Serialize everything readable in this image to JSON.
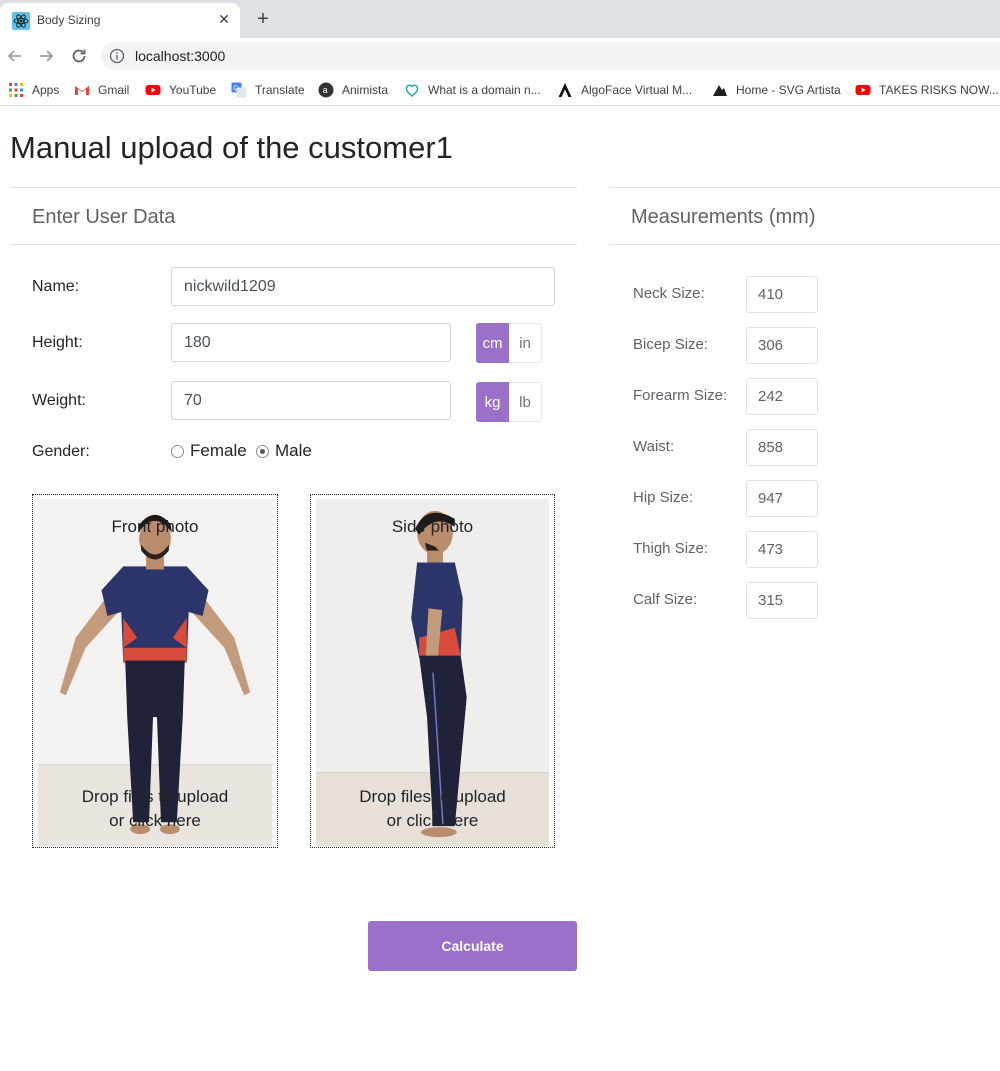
{
  "browser": {
    "tab_title": "Body Sizing",
    "url": "localhost:3000",
    "bookmarks": [
      "Apps",
      "Gmail",
      "YouTube",
      "Translate",
      "Animista",
      "What is a domain n...",
      "AlgoFace Virtual M...",
      "Home - SVG Artista",
      "TAKES RISKS NOW..."
    ]
  },
  "page": {
    "title": "Manual upload of the customer1"
  },
  "form": {
    "heading": "Enter User Data",
    "name_label": "Name:",
    "name_value": "nickwild1209",
    "height_label": "Height:",
    "height_value": "180",
    "height_units": [
      "cm",
      "in"
    ],
    "weight_label": "Weight:",
    "weight_value": "70",
    "weight_units": [
      "kg",
      "lb"
    ],
    "gender_label": "Gender:",
    "gender_options": [
      "Female",
      "Male"
    ],
    "gender_selected": "Male",
    "front": {
      "title": "Front photo",
      "hint": [
        "Drop files to upload",
        "or click here"
      ]
    },
    "side": {
      "title": "Side photo",
      "hint": [
        "Drop files to upload",
        "or click here"
      ]
    },
    "calculate_label": "Calculate"
  },
  "measurements": {
    "heading": "Measurements (mm)",
    "items": [
      {
        "label": "Neck Size:",
        "value": "410"
      },
      {
        "label": "Bicep Size:",
        "value": "306"
      },
      {
        "label": "Forearm Size:",
        "value": "242"
      },
      {
        "label": "Waist:",
        "value": "858"
      },
      {
        "label": "Hip Size:",
        "value": "947"
      },
      {
        "label": "Thigh Size:",
        "value": "473"
      },
      {
        "label": "Calf Size:",
        "value": "315"
      }
    ]
  },
  "colors": {
    "accent": "#9a70c9",
    "tab_strip": "#dee1e6",
    "omnibox": "#f1f3f4"
  }
}
